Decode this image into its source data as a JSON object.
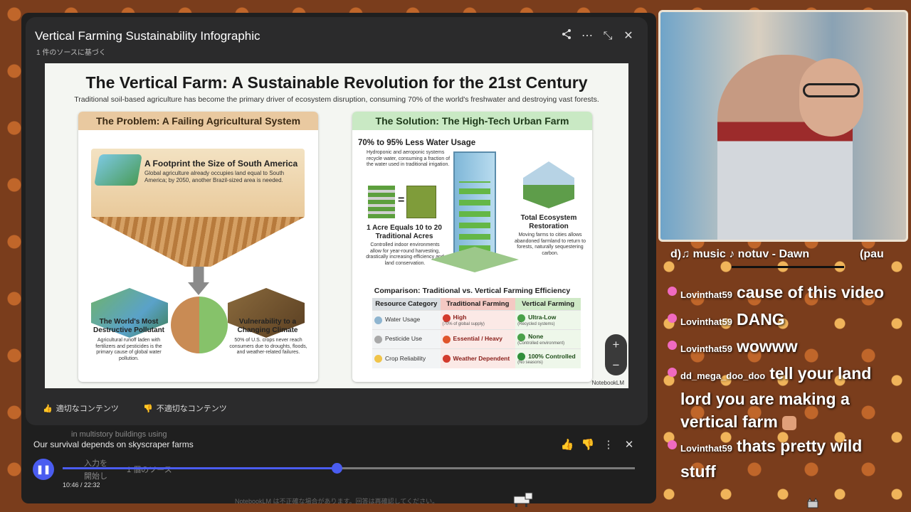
{
  "card": {
    "title": "Vertical Farming Sustainability Infographic",
    "subtitle": "1 件のソースに基づく"
  },
  "toolbar": {
    "share_icon": "share-icon",
    "more_icon": "more-vert-icon",
    "collapse_icon": "collapse-icon",
    "close_icon": "close-icon"
  },
  "slide": {
    "title": "The Vertical Farm: A Sustainable Revolution for the 21st Century",
    "subtitle": "Traditional soil-based agriculture has become the primary driver of ecosystem disruption, consuming 70% of the world's freshwater and destroying vast forests.",
    "problem": {
      "header": "The Problem: A Failing Agricultural System",
      "footprint_title": "A Footprint the Size of South America",
      "footprint_text": "Global agriculture already occupies land equal to South America; by 2050, another Brazil-sized area is needed.",
      "pollutant_title": "The World's Most Destructive Pollutant",
      "pollutant_text": "Agricultural runoff laden with fertilizers and pesticides is the primary cause of global water pollution.",
      "climate_title": "Vulnerability to a Changing Climate",
      "climate_text": "50% of U.S. crops never reach consumers due to droughts, floods, and weather-related failures."
    },
    "solution": {
      "header": "The Solution: The High-Tech Urban Farm",
      "water_title": "70% to 95% Less Water Usage",
      "water_text": "Hydroponic and aeroponic systems recycle water, consuming a fraction of the water used in traditional irrigation.",
      "acre_title": "1 Acre Equals 10 to 20 Traditional Acres",
      "acre_text": "Controlled indoor environments allow for year-round harvesting, drastically increasing efficiency and land conservation.",
      "eco_title": "Total Ecosystem Restoration",
      "eco_text": "Moving farms to cities allows abandoned farmland to return to forests, naturally sequestering carbon.",
      "compare_title": "Comparison: Traditional vs. Vertical Farming Efficiency",
      "table": {
        "headers": [
          "Resource Category",
          "Traditional Farming",
          "Vertical Farming"
        ],
        "rows": [
          {
            "category": "Water Usage",
            "traditional": "High",
            "traditional_note": "(70% of global supply)",
            "vertical": "Ultra-Low",
            "vertical_note": "(Recycled systems)"
          },
          {
            "category": "Pesticide Use",
            "traditional": "Essential / Heavy",
            "traditional_note": "",
            "vertical": "None",
            "vertical_note": "(Controlled environment)"
          },
          {
            "category": "Crop Reliability",
            "traditional": "Weather Dependent",
            "traditional_note": "",
            "vertical": "100% Controlled",
            "vertical_note": "(No seasons)"
          }
        ]
      }
    },
    "brand": "NotebookLM"
  },
  "feedback": {
    "good": "適切なコンテンツ",
    "bad": "不適切なコンテンツ"
  },
  "ghost": {
    "line1": "in multistory buildings using",
    "line2": "入力を",
    "line3": "開始し",
    "line4": "1 個のソース"
  },
  "player": {
    "title": "Our survival depends on skyscraper farms",
    "time": "10:46 / 22:32",
    "progress": 0.479
  },
  "footnote": "NotebookLM は不正確な場合があります。回答は再確認してください。",
  "stream": {
    "now_playing": "d)♫ music ♪ notuv - Dawn",
    "now_playing_tail": "(pau",
    "chat": [
      {
        "user": "Lovinthat59",
        "text": "cause of this video"
      },
      {
        "user": "Lovinthat59",
        "text": "DANG"
      },
      {
        "user": "Lovinthat59",
        "text": "wowww"
      },
      {
        "user": "dd_mega_doo_doo",
        "text": "tell your land lord you are making a vertical farm"
      },
      {
        "user": "Lovinthat59",
        "text": "thats pretty wild stuff"
      }
    ]
  },
  "colors": {
    "accent": "#4a5cf0",
    "badge": "#f06ac0"
  }
}
